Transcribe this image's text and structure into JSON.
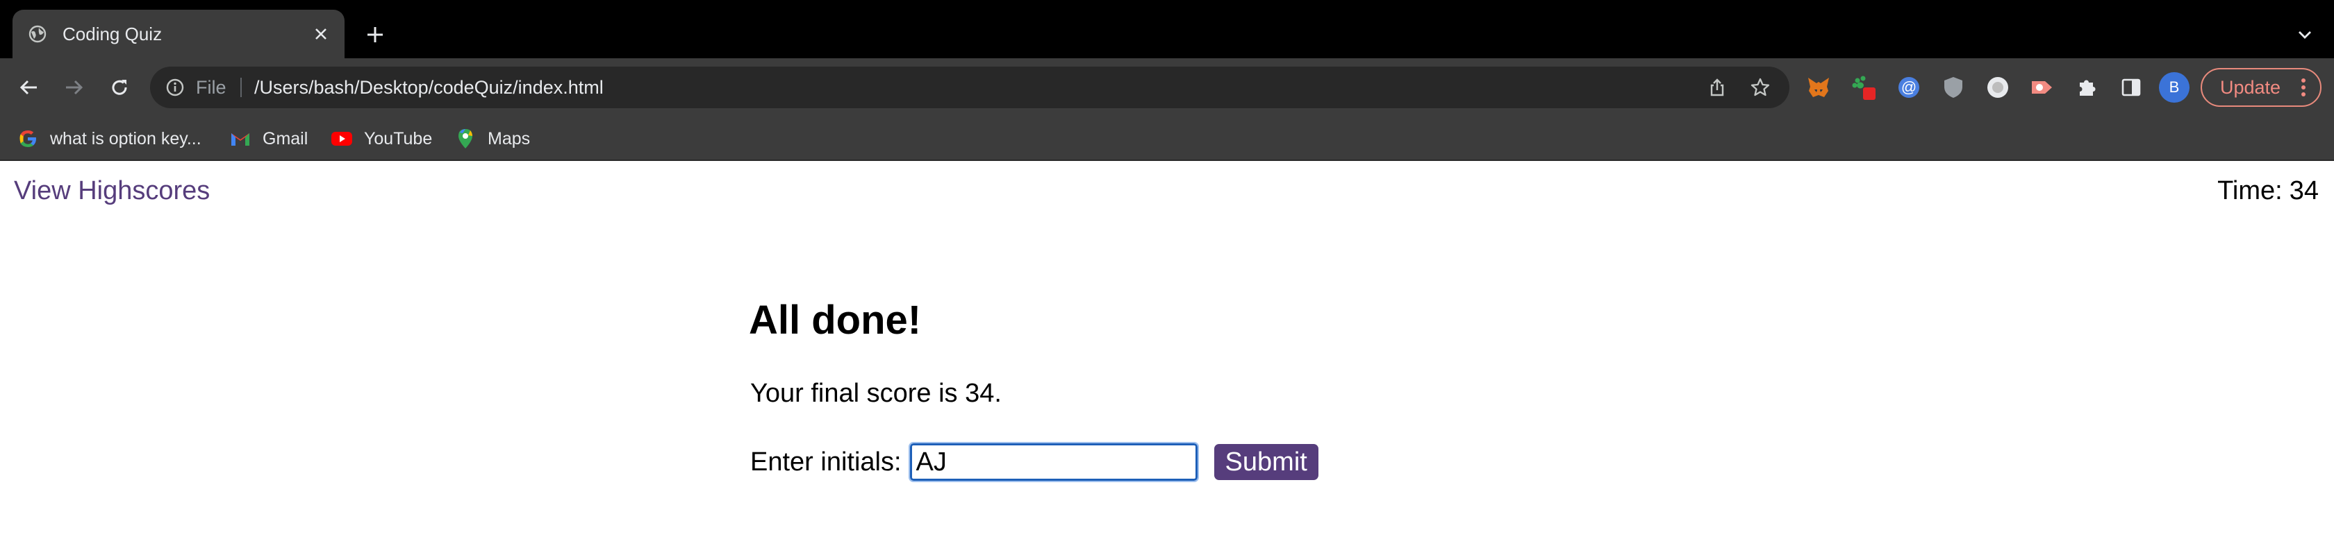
{
  "browser": {
    "tab": {
      "title": "Coding Quiz",
      "favicon": "globe-icon"
    },
    "address_bar": {
      "scheme_label": "File",
      "url": "/Users/bash/Desktop/codeQuiz/index.html"
    },
    "update_button_label": "Update",
    "profile_initial": "B",
    "bookmarks": [
      {
        "label": "what is option key...",
        "icon": "google-icon"
      },
      {
        "label": "Gmail",
        "icon": "gmail-icon"
      },
      {
        "label": "YouTube",
        "icon": "youtube-icon"
      },
      {
        "label": "Maps",
        "icon": "maps-icon"
      }
    ],
    "colors": {
      "tab_bg": "#3c3c3c",
      "chrome_bg": "#000000",
      "update_accent": "#f28b82",
      "avatar": "#3b73d8"
    }
  },
  "page": {
    "highscores_link": "View Highscores",
    "timer_label": "Time:",
    "timer_value": "34",
    "heading": "All done!",
    "final_score_text": "Your final score is 34.",
    "initials_label": "Enter initials:",
    "initials_value": "AJ",
    "submit_label": "Submit",
    "colors": {
      "accent": "#563d7c"
    }
  }
}
